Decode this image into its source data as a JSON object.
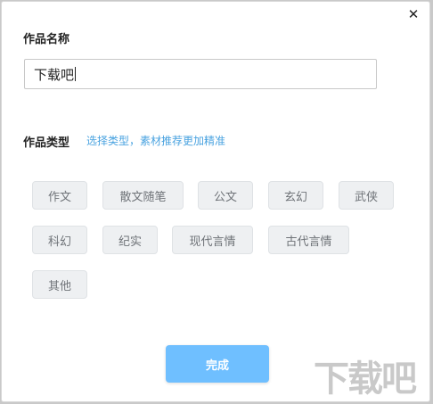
{
  "dialog": {
    "name_label": "作品名称",
    "name_value": "下载吧",
    "type_label": "作品类型",
    "type_hint": "选择类型，素材推荐更加精准",
    "done_label": "完成",
    "close_glyph": "✕"
  },
  "tags": [
    "作文",
    "散文随笔",
    "公文",
    "玄幻",
    "武侠",
    "科幻",
    "纪实",
    "现代言情",
    "古代言情",
    "其他"
  ],
  "watermark": "下载吧",
  "colors": {
    "accent": "#6fbfff",
    "hint": "#4aa3e0",
    "tag_bg": "#eef0f2"
  }
}
